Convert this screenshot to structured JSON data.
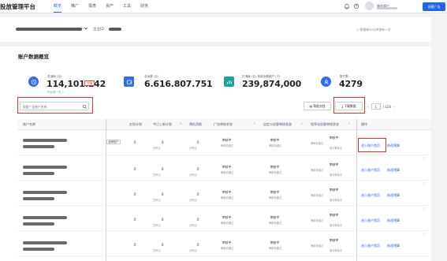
{
  "header": {
    "brand": "投放管理平台",
    "nav": [
      "概览",
      "推广",
      "报表",
      "资产",
      "工具",
      "财务"
    ],
    "user_label": "服务商户",
    "create_label": "创建广告"
  },
  "subbar": {
    "account_id_label": "企业ID:",
    "refresh_text": "数据每30分钟更新一次"
  },
  "overview": {
    "title": "账户数据概览",
    "kpis": [
      {
        "label": "总消耗 (元)",
        "value": "114,101.142",
        "badge": "下降",
        "note": "环比前一天 ↓"
      },
      {
        "label": "总余额 (元)",
        "value": "6.616.807.751"
      },
      {
        "label": "日消耗 (元)   投放余额超户 (个)",
        "value": "239,874,000"
      },
      {
        "label": "账户数",
        "value": "4279"
      }
    ]
  },
  "toolbar": {
    "search_placeholder": "搜索广告账户名称",
    "doc_label": "帮助文档",
    "download_label": "下载数据",
    "page_current": "1",
    "page_total": "/ 428"
  },
  "table": {
    "columns": [
      "账户名称",
      "在投计划",
      "今日上新计划",
      "预估消耗",
      "广告审核状态",
      "自定义创意审核状态",
      "程序化创意审核状态",
      "操作"
    ],
    "account_tag": "品牌账户",
    "zero": "0",
    "zero_sub": "日环比",
    "status_main": "审核中",
    "status_sub": "审核未通过",
    "status_sub2": "部分审核中",
    "op_primary": "进入账户首页",
    "op_secondary": "修改预算"
  },
  "colors": {
    "primary": "#1d66f0",
    "highlight": "#e8322c"
  }
}
